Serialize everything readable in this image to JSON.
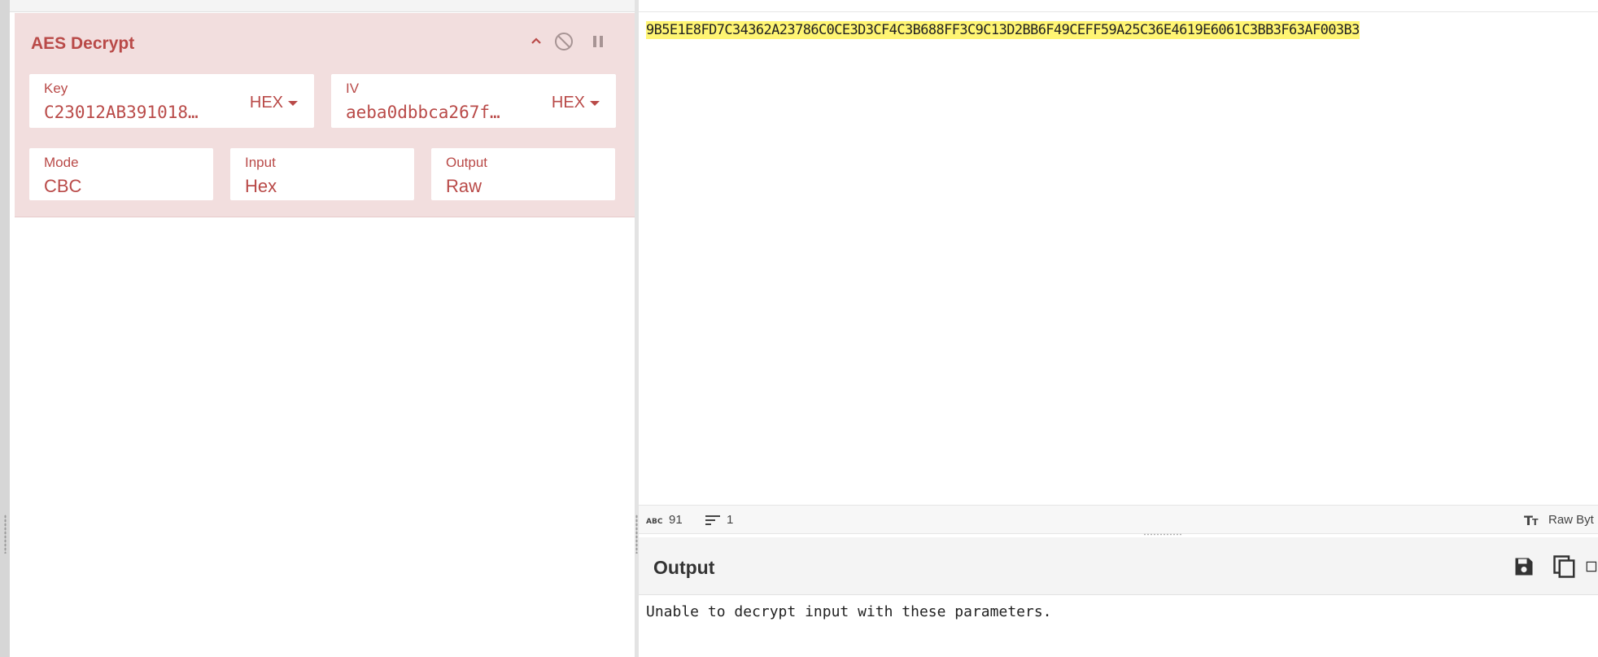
{
  "operation": {
    "title": "AES Decrypt",
    "key": {
      "label": "Key",
      "value": "C23012AB391018…",
      "format": "HEX"
    },
    "iv": {
      "label": "IV",
      "value": "aeba0dbbca267f…",
      "format": "HEX"
    },
    "mode": {
      "label": "Mode",
      "value": "CBC"
    },
    "input": {
      "label": "Input",
      "value": "Hex"
    },
    "output": {
      "label": "Output",
      "value": "Raw"
    }
  },
  "input_pane": {
    "text": "9B5E1E8FD7C34362A23786C0CE3D3CF4C3B688FF3C9C13D2BB6F49CEFF59A25C36E4619E6061C3BB3F63AF003B3",
    "status": {
      "length": "91",
      "lines": "1",
      "encoding": "Raw Byt"
    }
  },
  "output_pane": {
    "title": "Output",
    "text": "Unable to decrypt input with these parameters."
  }
}
